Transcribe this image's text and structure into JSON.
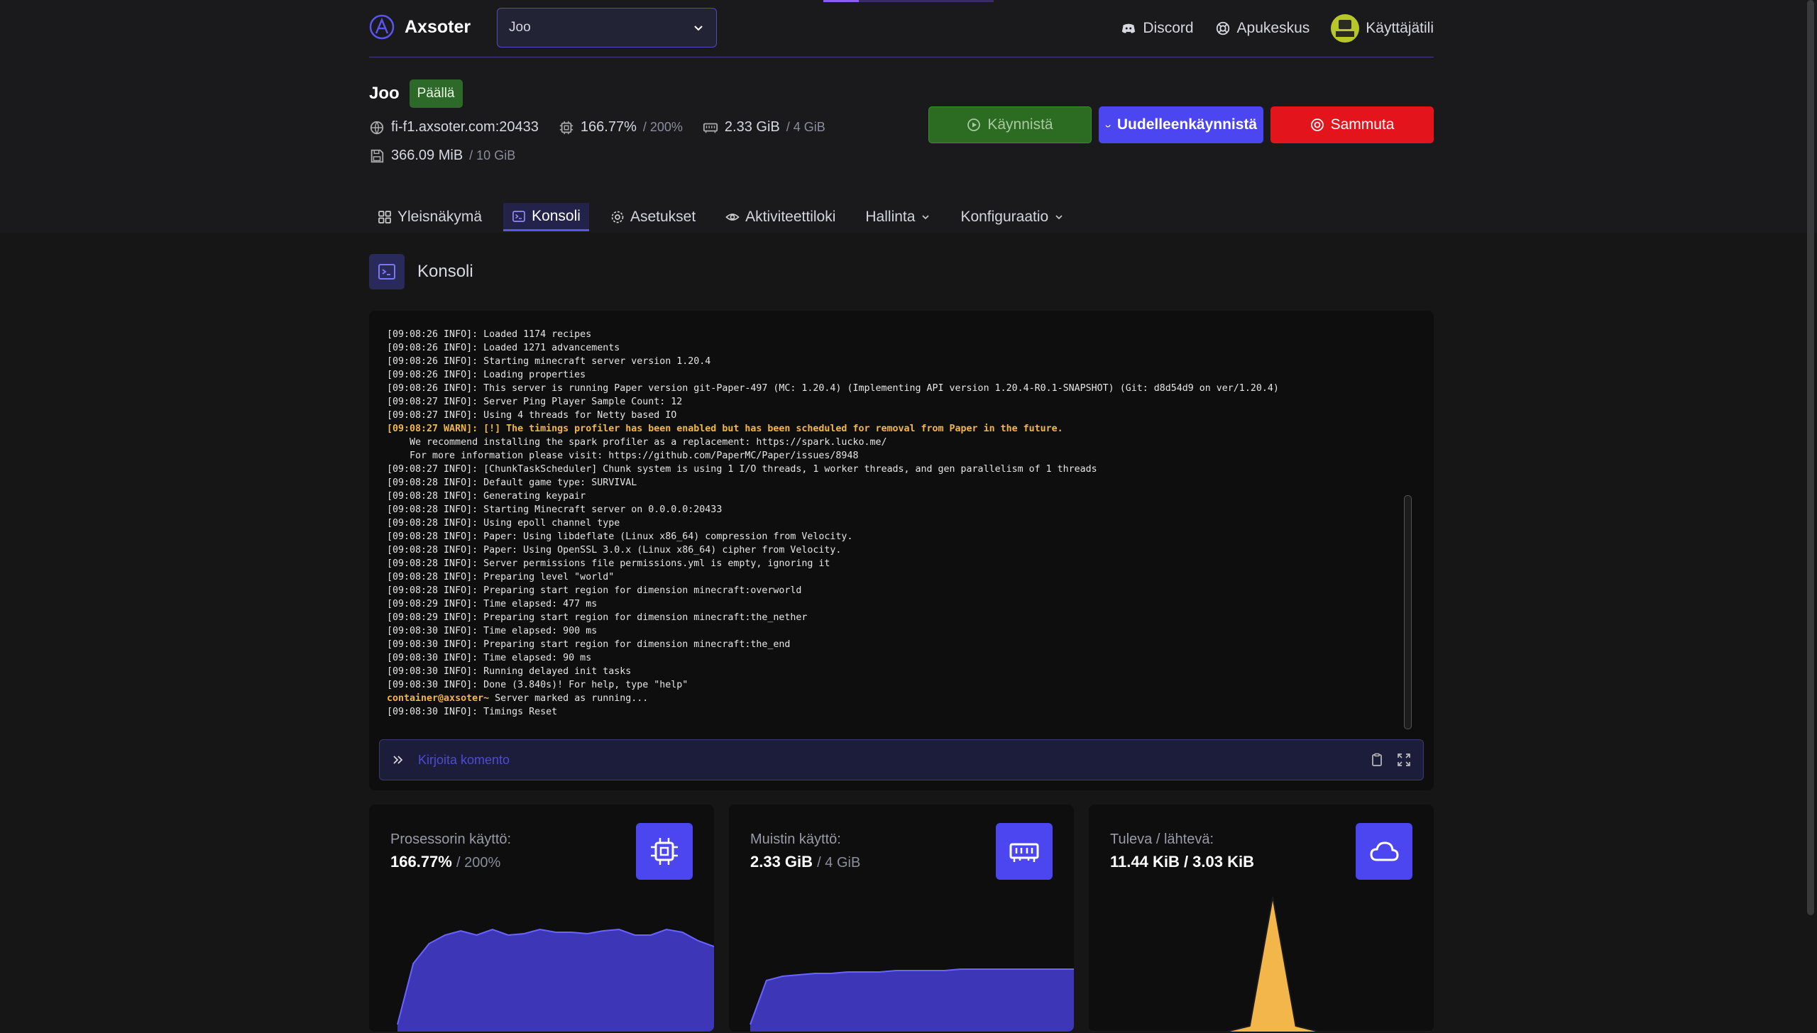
{
  "header": {
    "brand": "Axsoter",
    "server_select": "Joo",
    "links": {
      "discord": "Discord",
      "help": "Apukeskus",
      "account": "Käyttäjätili"
    }
  },
  "server": {
    "name": "Joo",
    "status": "Päällä",
    "address": "fi-f1.axsoter.com:20433",
    "cpu": "166.77%",
    "cpu_limit": "/ 200%",
    "memory": "2.33 GiB",
    "memory_limit": "/ 4 GiB",
    "disk": "366.09 MiB",
    "disk_limit": "/ 10 GiB"
  },
  "power": {
    "start": "Käynnistä",
    "restart": "Uudelleenkäynnistä",
    "stop": "Sammuta"
  },
  "tabs": [
    {
      "label": "Yleisnäkymä",
      "icon": "grid-icon"
    },
    {
      "label": "Konsoli",
      "icon": "terminal-icon",
      "active": true
    },
    {
      "label": "Asetukset",
      "icon": "gear-icon"
    },
    {
      "label": "Aktiviteettiloki",
      "icon": "eye-icon"
    },
    {
      "label": "Hallinta",
      "dropdown": true
    },
    {
      "label": "Konfiguraatio",
      "dropdown": true
    }
  ],
  "console": {
    "title": "Konsoli",
    "placeholder": "Kirjoita komento",
    "lines": [
      {
        "t": "[09:08:26 INFO]: Loaded 1174 recipes"
      },
      {
        "t": "[09:08:26 INFO]: Loaded 1271 advancements"
      },
      {
        "t": "[09:08:26 INFO]: Starting minecraft server version 1.20.4"
      },
      {
        "t": "[09:08:26 INFO]: Loading properties"
      },
      {
        "t": "[09:08:26 INFO]: This server is running Paper version git-Paper-497 (MC: 1.20.4) (Implementing API version 1.20.4-R0.1-SNAPSHOT) (Git: d8d54d9 on ver/1.20.4)"
      },
      {
        "t": "[09:08:27 INFO]: Server Ping Player Sample Count: 12"
      },
      {
        "t": "[09:08:27 INFO]: Using 4 threads for Netty based IO"
      },
      {
        "t": "[09:08:27 WARN]: [!] The timings profiler has been enabled but has been scheduled for removal from Paper in the future.",
        "kind": "warn"
      },
      {
        "t": "    We recommend installing the spark profiler as a replacement: https://spark.lucko.me/"
      },
      {
        "t": "    For more information please visit: https://github.com/PaperMC/Paper/issues/8948"
      },
      {
        "t": "[09:08:27 INFO]: [ChunkTaskScheduler] Chunk system is using 1 I/O threads, 1 worker threads, and gen parallelism of 1 threads"
      },
      {
        "t": "[09:08:28 INFO]: Default game type: SURVIVAL"
      },
      {
        "t": "[09:08:28 INFO]: Generating keypair"
      },
      {
        "t": "[09:08:28 INFO]: Starting Minecraft server on 0.0.0.0:20433"
      },
      {
        "t": "[09:08:28 INFO]: Using epoll channel type"
      },
      {
        "t": "[09:08:28 INFO]: Paper: Using libdeflate (Linux x86_64) compression from Velocity."
      },
      {
        "t": "[09:08:28 INFO]: Paper: Using OpenSSL 3.0.x (Linux x86_64) cipher from Velocity."
      },
      {
        "t": "[09:08:28 INFO]: Server permissions file permissions.yml is empty, ignoring it"
      },
      {
        "t": "[09:08:28 INFO]: Preparing level \"world\""
      },
      {
        "t": "[09:08:28 INFO]: Preparing start region for dimension minecraft:overworld"
      },
      {
        "t": "[09:08:29 INFO]: Time elapsed: 477 ms"
      },
      {
        "t": "[09:08:29 INFO]: Preparing start region for dimension minecraft:the_nether"
      },
      {
        "t": "[09:08:30 INFO]: Time elapsed: 900 ms"
      },
      {
        "t": "[09:08:30 INFO]: Preparing start region for dimension minecraft:the_end"
      },
      {
        "t": "[09:08:30 INFO]: Time elapsed: 90 ms"
      },
      {
        "t": "[09:08:30 INFO]: Running delayed init tasks"
      },
      {
        "t": "[09:08:30 INFO]: Done (3.840s)! For help, type \"help\""
      },
      {
        "t": " Server marked as running...",
        "prompt": "container@axsoter~"
      },
      {
        "t": "[09:08:30 INFO]: Timings Reset"
      }
    ]
  },
  "cards": {
    "cpu": {
      "label": "Prosessorin käyttö:",
      "value": "166.77%",
      "limit": "/ 200%"
    },
    "memory": {
      "label": "Muistin käyttö:",
      "value": "2.33 GiB",
      "limit": "/ 4 GiB"
    },
    "network": {
      "label": "Tuleva / lähtevä:",
      "value": "11.44 KiB / 3.03 KiB"
    }
  },
  "colors": {
    "accent": "#4b46f0",
    "start": "#2c6b22",
    "stop": "#e3141c",
    "warn": "#f2b64a",
    "chart_fill": "#3d37b8",
    "chart_line": "#6a64ff",
    "net_out": "#f2b64a"
  },
  "chart_data": [
    {
      "type": "area",
      "series": [
        {
          "values": [
            5,
            48,
            62,
            68,
            71,
            68,
            72,
            68,
            69,
            72,
            70,
            70,
            69,
            71,
            72,
            68,
            68,
            72,
            70,
            64,
            60
          ]
        }
      ],
      "ylim": [
        0,
        100
      ]
    },
    {
      "type": "area",
      "series": [
        {
          "values": [
            5,
            36,
            39,
            40,
            41,
            41,
            42,
            42,
            42,
            43,
            43,
            43,
            43,
            44,
            44,
            44,
            44,
            44,
            44,
            44,
            44
          ]
        }
      ],
      "ylim": [
        0,
        100
      ]
    },
    {
      "type": "area",
      "series": [
        {
          "values": [
            0,
            0,
            0,
            0,
            0,
            0,
            0,
            0,
            0,
            0,
            0,
            0,
            0,
            0,
            0,
            0
          ]
        },
        {
          "values": [
            0,
            0,
            0,
            0,
            0,
            0,
            0,
            4,
            95,
            4,
            0,
            0,
            0,
            0,
            0,
            0
          ]
        }
      ],
      "ylim": [
        0,
        100
      ]
    }
  ]
}
